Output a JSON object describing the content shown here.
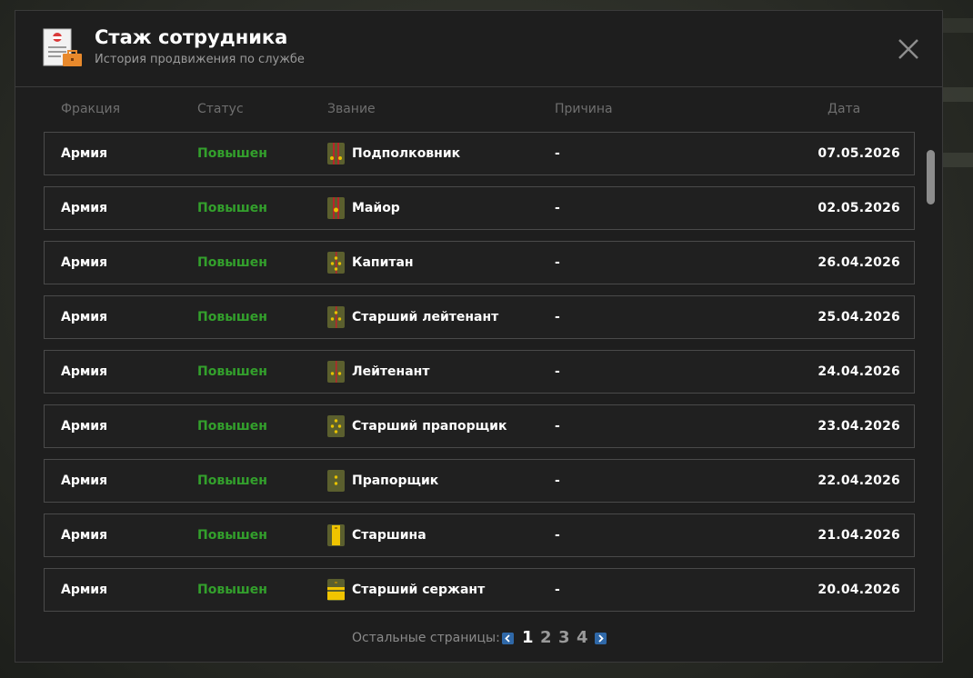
{
  "window": {
    "title": "Стаж сотрудника",
    "subtitle": "История продвижения по службе",
    "icon": "employee-record-icon",
    "close_icon": "close-icon"
  },
  "columns": {
    "faction": "Фракция",
    "status": "Статус",
    "rank": "Звание",
    "reason": "Причина",
    "date": "Дата"
  },
  "rows": [
    {
      "faction": "Армия",
      "status": "Повышен",
      "rank": "Подполковник",
      "reason": "-",
      "date": "07.05.2026",
      "rank_icon": "lieutenant-colonel-insignia-icon"
    },
    {
      "faction": "Армия",
      "status": "Повышен",
      "rank": "Майор",
      "reason": "-",
      "date": "02.05.2026",
      "rank_icon": "major-insignia-icon"
    },
    {
      "faction": "Армия",
      "status": "Повышен",
      "rank": "Капитан",
      "reason": "-",
      "date": "26.04.2026",
      "rank_icon": "captain-insignia-icon"
    },
    {
      "faction": "Армия",
      "status": "Повышен",
      "rank": "Старший лейтенант",
      "reason": "-",
      "date": "25.04.2026",
      "rank_icon": "senior-lieutenant-insignia-icon"
    },
    {
      "faction": "Армия",
      "status": "Повышен",
      "rank": "Лейтенант",
      "reason": "-",
      "date": "24.04.2026",
      "rank_icon": "lieutenant-insignia-icon"
    },
    {
      "faction": "Армия",
      "status": "Повышен",
      "rank": "Старший прапорщик",
      "reason": "-",
      "date": "23.04.2026",
      "rank_icon": "senior-warrant-officer-insignia-icon"
    },
    {
      "faction": "Армия",
      "status": "Повышен",
      "rank": "Прапорщик",
      "reason": "-",
      "date": "22.04.2026",
      "rank_icon": "warrant-officer-insignia-icon"
    },
    {
      "faction": "Армия",
      "status": "Повышен",
      "rank": "Старшина",
      "reason": "-",
      "date": "21.04.2026",
      "rank_icon": "sergeant-major-insignia-icon"
    },
    {
      "faction": "Армия",
      "status": "Повышен",
      "rank": "Старший сержант",
      "reason": "-",
      "date": "20.04.2026",
      "rank_icon": "senior-sergeant-insignia-icon"
    }
  ],
  "pager": {
    "label": "Остальные страницы:",
    "pages": [
      "1",
      "2",
      "3",
      "4"
    ],
    "current": "1",
    "prev_icon": "chevron-left-icon",
    "next_icon": "chevron-right-icon"
  },
  "colors": {
    "status_promoted": "#33a02c",
    "pager_button": "#2f68a8"
  }
}
